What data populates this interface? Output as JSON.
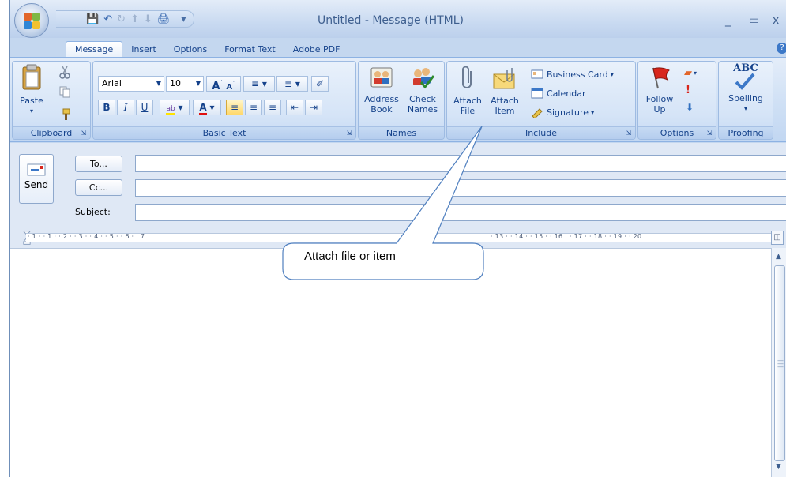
{
  "window": {
    "title": "Untitled - Message (HTML)",
    "controls": [
      "_",
      "▭",
      "x"
    ]
  },
  "tabs": [
    "Message",
    "Insert",
    "Options",
    "Format Text",
    "Adobe PDF"
  ],
  "ribbon": {
    "clipboard": {
      "label": "Clipboard",
      "paste": "Paste"
    },
    "basic_text": {
      "label": "Basic Text",
      "font": "Arial",
      "size": "10",
      "bold": "B",
      "italic": "I",
      "underline": "U",
      "grow": "A",
      "shrink": "A"
    },
    "names": {
      "label": "Names",
      "address_book": "Address\nBook",
      "check_names": "Check\nNames"
    },
    "include": {
      "label": "Include",
      "attach_file": "Attach\nFile",
      "attach_item": "Attach\nItem",
      "business_card": "Business Card",
      "calendar": "Calendar",
      "signature": "Signature"
    },
    "options": {
      "label": "Options",
      "follow_up": "Follow\nUp"
    },
    "proofing": {
      "label": "Proofing",
      "spelling": "Spelling",
      "abc": "ABC"
    }
  },
  "header": {
    "send": "Send",
    "to": "To...",
    "cc": "Cc...",
    "subject_label": "Subject:",
    "to_value": "",
    "cc_value": "",
    "subject_value": ""
  },
  "ruler": {
    "left_marks": "· 1 · · 1 · · 2 · · 3 · · 4 · · 5 · · 6 · · 7",
    "right_marks": "· 13 · · 14 · · 15 · · 16 · · 17 · · 18 · · 19 · · 20"
  },
  "callout": {
    "text": "Attach file or item"
  },
  "colors": {
    "ribbon_bg": "#cfe0f5",
    "accent_text": "#15428b",
    "flag_red": "#d8261c",
    "font_color_red": "#e01010",
    "highlight_yellow": "#ffe200"
  },
  "icons": [
    "office-button-icon",
    "save-icon",
    "undo-icon",
    "redo-icon",
    "up-arrow-icon",
    "down-arrow-icon",
    "print-icon",
    "paste-icon",
    "cut-icon",
    "copy-icon",
    "format-painter-icon",
    "address-book-icon",
    "check-names-icon",
    "paperclip-icon",
    "envelope-icon",
    "business-card-icon",
    "calendar-icon",
    "signature-icon",
    "flag-icon",
    "importance-high-icon",
    "importance-low-icon",
    "spelling-check-icon"
  ]
}
